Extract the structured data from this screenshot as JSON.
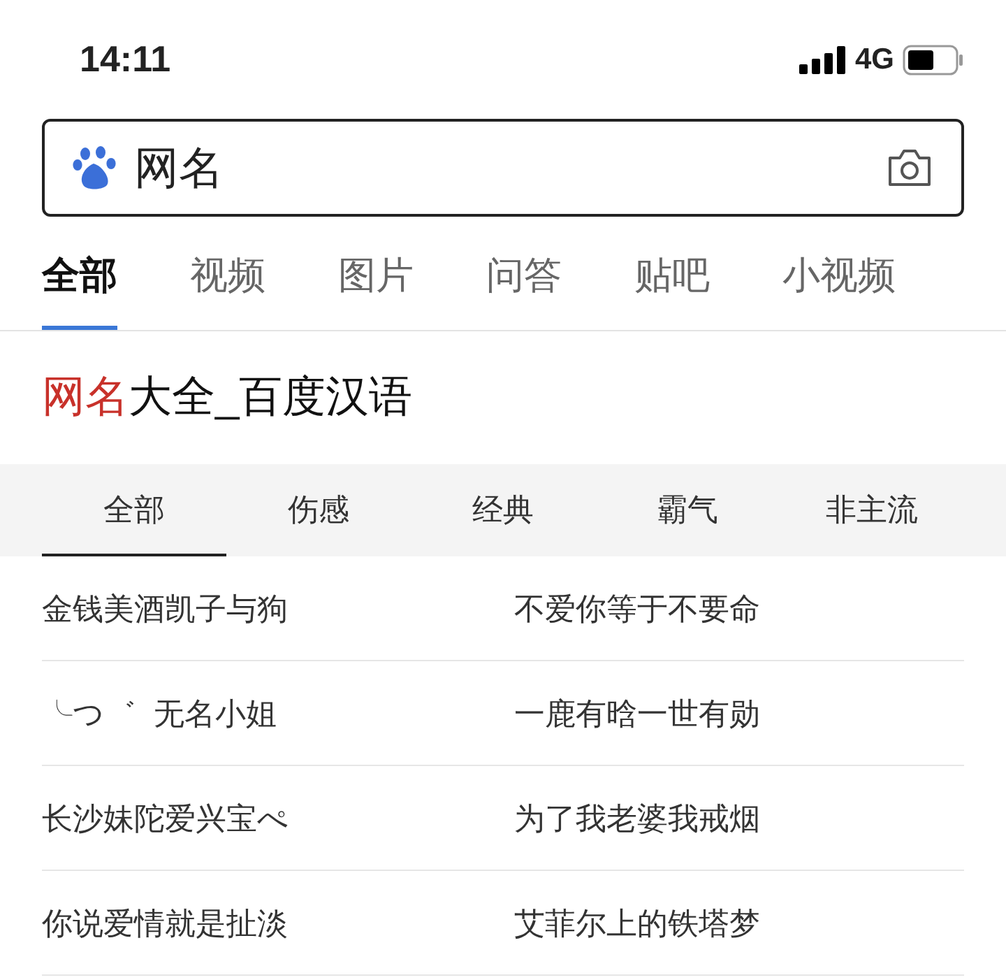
{
  "status_bar": {
    "time": "14:11",
    "network": "4G"
  },
  "search": {
    "value": "网名"
  },
  "tabs": [
    {
      "label": "全部",
      "selected": true
    },
    {
      "label": "视频",
      "selected": false
    },
    {
      "label": "图片",
      "selected": false
    },
    {
      "label": "问答",
      "selected": false
    },
    {
      "label": "贴吧",
      "selected": false
    },
    {
      "label": "小视频",
      "selected": false
    }
  ],
  "result": {
    "title_highlight": "网名",
    "title_rest": "大全_百度汉语",
    "sub_tabs": [
      {
        "label": "全部",
        "selected": true
      },
      {
        "label": "伤感",
        "selected": false
      },
      {
        "label": "经典",
        "selected": false
      },
      {
        "label": "霸气",
        "selected": false
      },
      {
        "label": "非主流",
        "selected": false
      }
    ],
    "names": [
      [
        "金钱美酒凯子与狗",
        "不爱你等于不要命"
      ],
      [
        "╰つ゛  无名小姐",
        "一鹿有晗一世有勋"
      ],
      [
        "长沙妹陀爱兴宝ぺ",
        "为了我老婆我戒烟"
      ],
      [
        "你说爱情就是扯淡",
        "艾菲尔上的铁塔梦"
      ]
    ]
  }
}
